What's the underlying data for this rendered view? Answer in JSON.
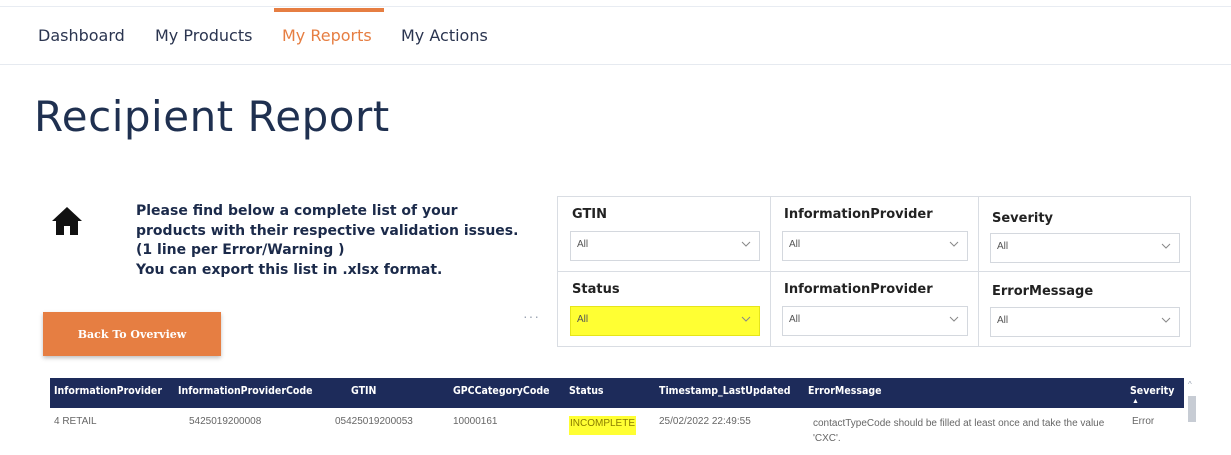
{
  "nav": {
    "items": [
      {
        "label": "Dashboard",
        "active": false
      },
      {
        "label": "My Products",
        "active": false
      },
      {
        "label": "My Reports",
        "active": true
      },
      {
        "label": "My Actions",
        "active": false
      }
    ]
  },
  "page": {
    "title": "Recipient Report",
    "intro_lines": [
      "Please find below a complete list of your",
      "products with their respective validation issues.",
      "(1 line per Error/Warning )",
      "You can export this list in .xlsx format."
    ],
    "back_button": "Back To Overview",
    "more_label": "···"
  },
  "filters": [
    {
      "label": "GTIN",
      "value": "All"
    },
    {
      "label": "InformationProvider",
      "value": "All"
    },
    {
      "label": "Severity",
      "value": "All"
    },
    {
      "label": "Status",
      "value": "All",
      "highlighted": true
    },
    {
      "label": "InformationProvider",
      "value": "All"
    },
    {
      "label": "ErrorMessage",
      "value": "All"
    }
  ],
  "table": {
    "columns": [
      "InformationProvider",
      "InformationProviderCode",
      "GTIN",
      "GPCCategoryCode",
      "Status",
      "Timestamp_LastUpdated",
      "ErrorMessage",
      "Severity"
    ],
    "sort_column": "Severity",
    "rows": [
      {
        "InformationProvider": "4 RETAIL",
        "InformationProviderCode": "5425019200008",
        "GTIN": "05425019200053",
        "GPCCategoryCode": "10000161",
        "Status": "INCOMPLETE",
        "Timestamp_LastUpdated": "25/02/2022 22:49:55",
        "ErrorMessage": "contactTypeCode should be filled at least once and take the value 'CXC'.",
        "Severity": "Error"
      }
    ]
  },
  "colors": {
    "accent": "#e67e42",
    "header_bg": "#1d2b5a",
    "highlight": "#ffff33"
  }
}
